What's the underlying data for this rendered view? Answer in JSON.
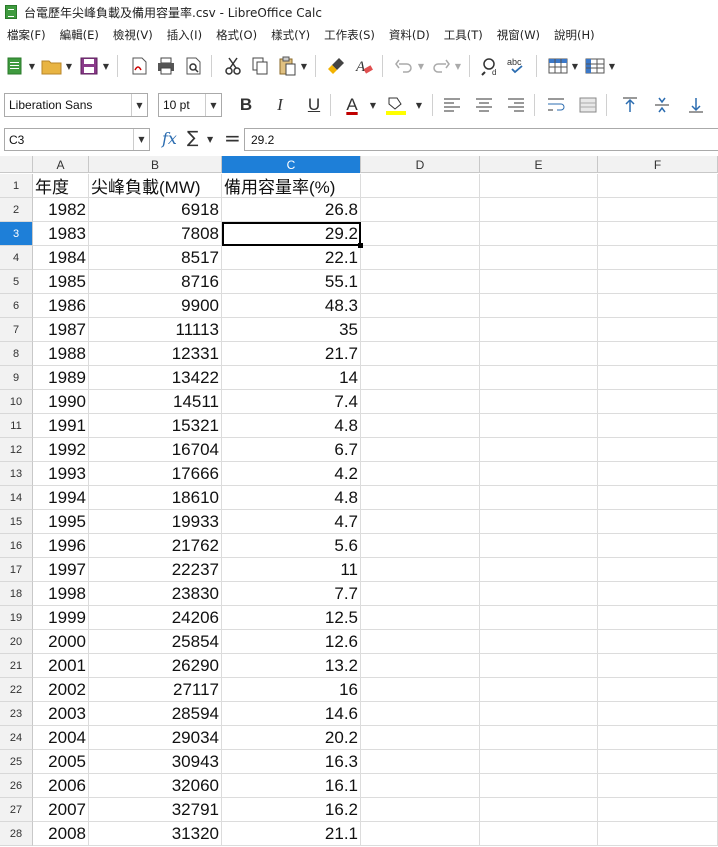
{
  "window": {
    "title": "台電歷年尖峰負載及備用容量率.csv - LibreOffice Calc"
  },
  "menu": [
    "檔案(F)",
    "編輯(E)",
    "檢視(V)",
    "插入(I)",
    "格式(O)",
    "樣式(Y)",
    "工作表(S)",
    "資料(D)",
    "工具(T)",
    "視窗(W)",
    "說明(H)"
  ],
  "format_bar": {
    "font_name": "Liberation Sans",
    "font_size": "10 pt",
    "bold": "B",
    "italic": "I",
    "underline": "U",
    "font_color_label": "A",
    "font_color": "#c00000",
    "highlight_color": "#ffff00"
  },
  "formula_bar": {
    "cell_ref": "C3",
    "fx": "fx",
    "sigma": "∑",
    "equals": "=",
    "content": "29.2"
  },
  "columns": [
    "A",
    "B",
    "C",
    "D",
    "E",
    "F"
  ],
  "active_column": "C",
  "active_row": "3",
  "header_row": {
    "row": "1",
    "cells": [
      "年度",
      "尖峰負載(MW)",
      "備用容量率(%)"
    ]
  },
  "rows": [
    {
      "row": "2",
      "cells": [
        "1982",
        "6918",
        "26.8"
      ]
    },
    {
      "row": "3",
      "cells": [
        "1983",
        "7808",
        "29.2"
      ]
    },
    {
      "row": "4",
      "cells": [
        "1984",
        "8517",
        "22.1"
      ]
    },
    {
      "row": "5",
      "cells": [
        "1985",
        "8716",
        "55.1"
      ]
    },
    {
      "row": "6",
      "cells": [
        "1986",
        "9900",
        "48.3"
      ]
    },
    {
      "row": "7",
      "cells": [
        "1987",
        "11113",
        "35"
      ]
    },
    {
      "row": "8",
      "cells": [
        "1988",
        "12331",
        "21.7"
      ]
    },
    {
      "row": "9",
      "cells": [
        "1989",
        "13422",
        "14"
      ]
    },
    {
      "row": "10",
      "cells": [
        "1990",
        "14511",
        "7.4"
      ]
    },
    {
      "row": "11",
      "cells": [
        "1991",
        "15321",
        "4.8"
      ]
    },
    {
      "row": "12",
      "cells": [
        "1992",
        "16704",
        "6.7"
      ]
    },
    {
      "row": "13",
      "cells": [
        "1993",
        "17666",
        "4.2"
      ]
    },
    {
      "row": "14",
      "cells": [
        "1994",
        "18610",
        "4.8"
      ]
    },
    {
      "row": "15",
      "cells": [
        "1995",
        "19933",
        "4.7"
      ]
    },
    {
      "row": "16",
      "cells": [
        "1996",
        "21762",
        "5.6"
      ]
    },
    {
      "row": "17",
      "cells": [
        "1997",
        "22237",
        "11"
      ]
    },
    {
      "row": "18",
      "cells": [
        "1998",
        "23830",
        "7.7"
      ]
    },
    {
      "row": "19",
      "cells": [
        "1999",
        "24206",
        "12.5"
      ]
    },
    {
      "row": "20",
      "cells": [
        "2000",
        "25854",
        "12.6"
      ]
    },
    {
      "row": "21",
      "cells": [
        "2001",
        "26290",
        "13.2"
      ]
    },
    {
      "row": "22",
      "cells": [
        "2002",
        "27117",
        "16"
      ]
    },
    {
      "row": "23",
      "cells": [
        "2003",
        "28594",
        "14.6"
      ]
    },
    {
      "row": "24",
      "cells": [
        "2004",
        "29034",
        "20.2"
      ]
    },
    {
      "row": "25",
      "cells": [
        "2005",
        "30943",
        "16.3"
      ]
    },
    {
      "row": "26",
      "cells": [
        "2006",
        "32060",
        "16.1"
      ]
    },
    {
      "row": "27",
      "cells": [
        "2007",
        "32791",
        "16.2"
      ]
    },
    {
      "row": "28",
      "cells": [
        "2008",
        "31320",
        "21.1"
      ]
    }
  ],
  "toolbar_icons": [
    "new-spreadsheet-icon",
    "open-folder-icon",
    "save-icon",
    "export-pdf-icon",
    "print-icon",
    "print-preview-icon",
    "cut-icon",
    "copy-icon",
    "paste-icon",
    "clone-formatting-icon",
    "clear-formatting-icon",
    "undo-icon",
    "redo-icon",
    "find-replace-icon",
    "spellcheck-icon",
    "row-icon",
    "column-icon"
  ]
}
